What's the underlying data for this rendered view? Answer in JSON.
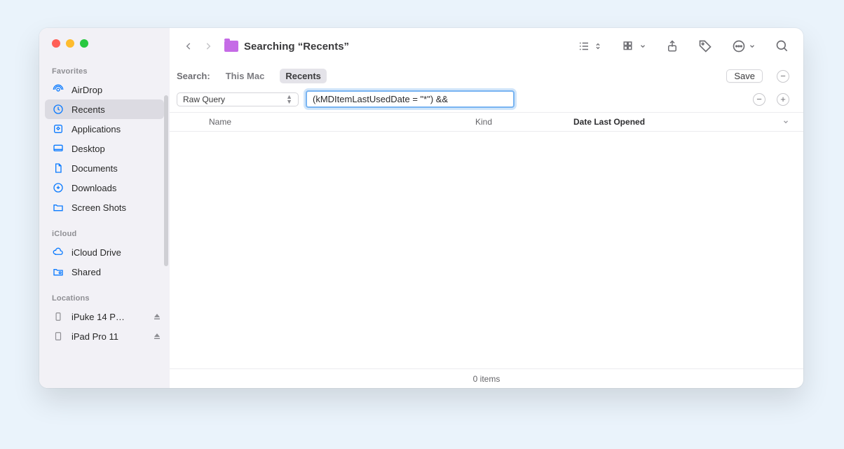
{
  "sidebar": {
    "favorites_label": "Favorites",
    "icloud_label": "iCloud",
    "locations_label": "Locations",
    "items": {
      "airdrop": "AirDrop",
      "recents": "Recents",
      "applications": "Applications",
      "desktop": "Desktop",
      "documents": "Documents",
      "downloads": "Downloads",
      "screenshots": "Screen Shots",
      "icloud_drive": "iCloud Drive",
      "shared": "Shared",
      "iphone": "iPuke 14 P…",
      "ipad": "iPad Pro 11"
    }
  },
  "toolbar": {
    "title": "Searching “Recents”"
  },
  "scope": {
    "label": "Search:",
    "this_mac": "This Mac",
    "recents": "Recents",
    "save": "Save"
  },
  "criteria": {
    "selector": "Raw Query",
    "query": "(kMDItemLastUsedDate = \"*\") &&"
  },
  "columns": {
    "name": "Name",
    "kind": "Kind",
    "date": "Date Last Opened"
  },
  "status": {
    "items": "0 items"
  }
}
